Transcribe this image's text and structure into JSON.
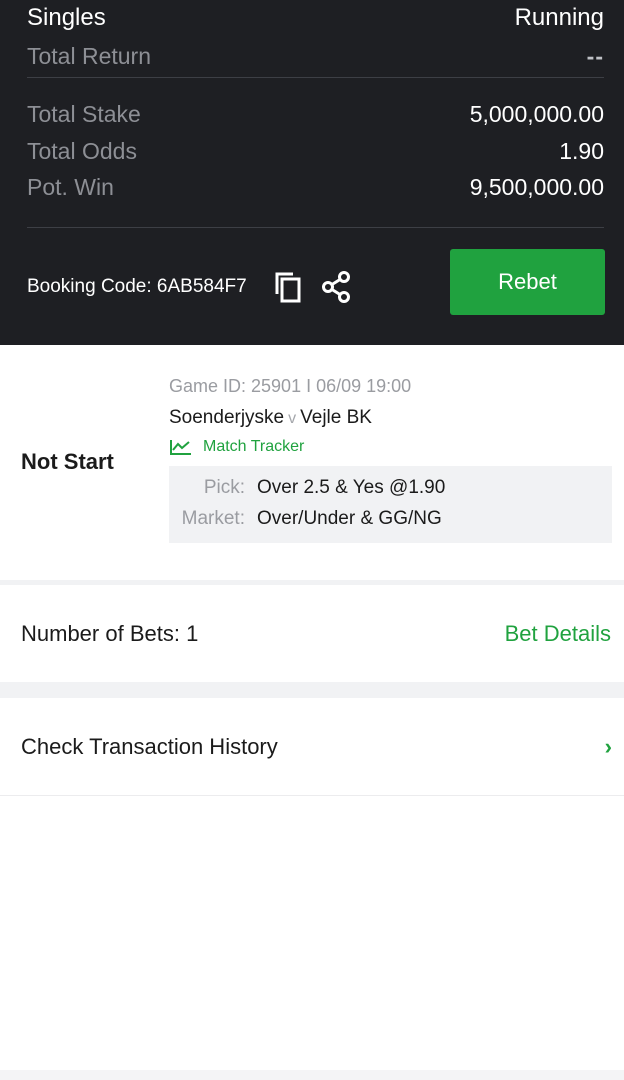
{
  "header": {
    "title": "Singles",
    "status": "Running",
    "total_return_label": "Total Return",
    "total_return_value": "--",
    "summary": [
      {
        "label": "Total Stake",
        "value": "5,000,000.00"
      },
      {
        "label": "Total Odds",
        "value": "1.90"
      },
      {
        "label": "Pot. Win",
        "value": "9,500,000.00"
      }
    ],
    "booking_code": "Booking Code: 6AB584F7",
    "rebet_label": "Rebet",
    "icons": [
      "copy-icon",
      "share-icon"
    ]
  },
  "bet": {
    "status": "Not Start",
    "game_id": "Game ID: 25901 I 06/09 19:00",
    "home": "Soenderjyske",
    "vs": "v",
    "away": "Vejle BK",
    "tracker_label": "Match Tracker",
    "pick_label": "Pick:",
    "pick_value": "Over 2.5 & Yes @1.90",
    "market_label": "Market:",
    "market_value": "Over/Under & GG/NG"
  },
  "bets_info": {
    "label": "Number of Bets: 1",
    "link": "Bet Details"
  },
  "history": {
    "label": "Check Transaction History",
    "chevron": "›"
  },
  "colors": {
    "header_bg": "#1e1f23",
    "accent_green": "#20a23f",
    "muted_gray": "#8d8f95"
  }
}
